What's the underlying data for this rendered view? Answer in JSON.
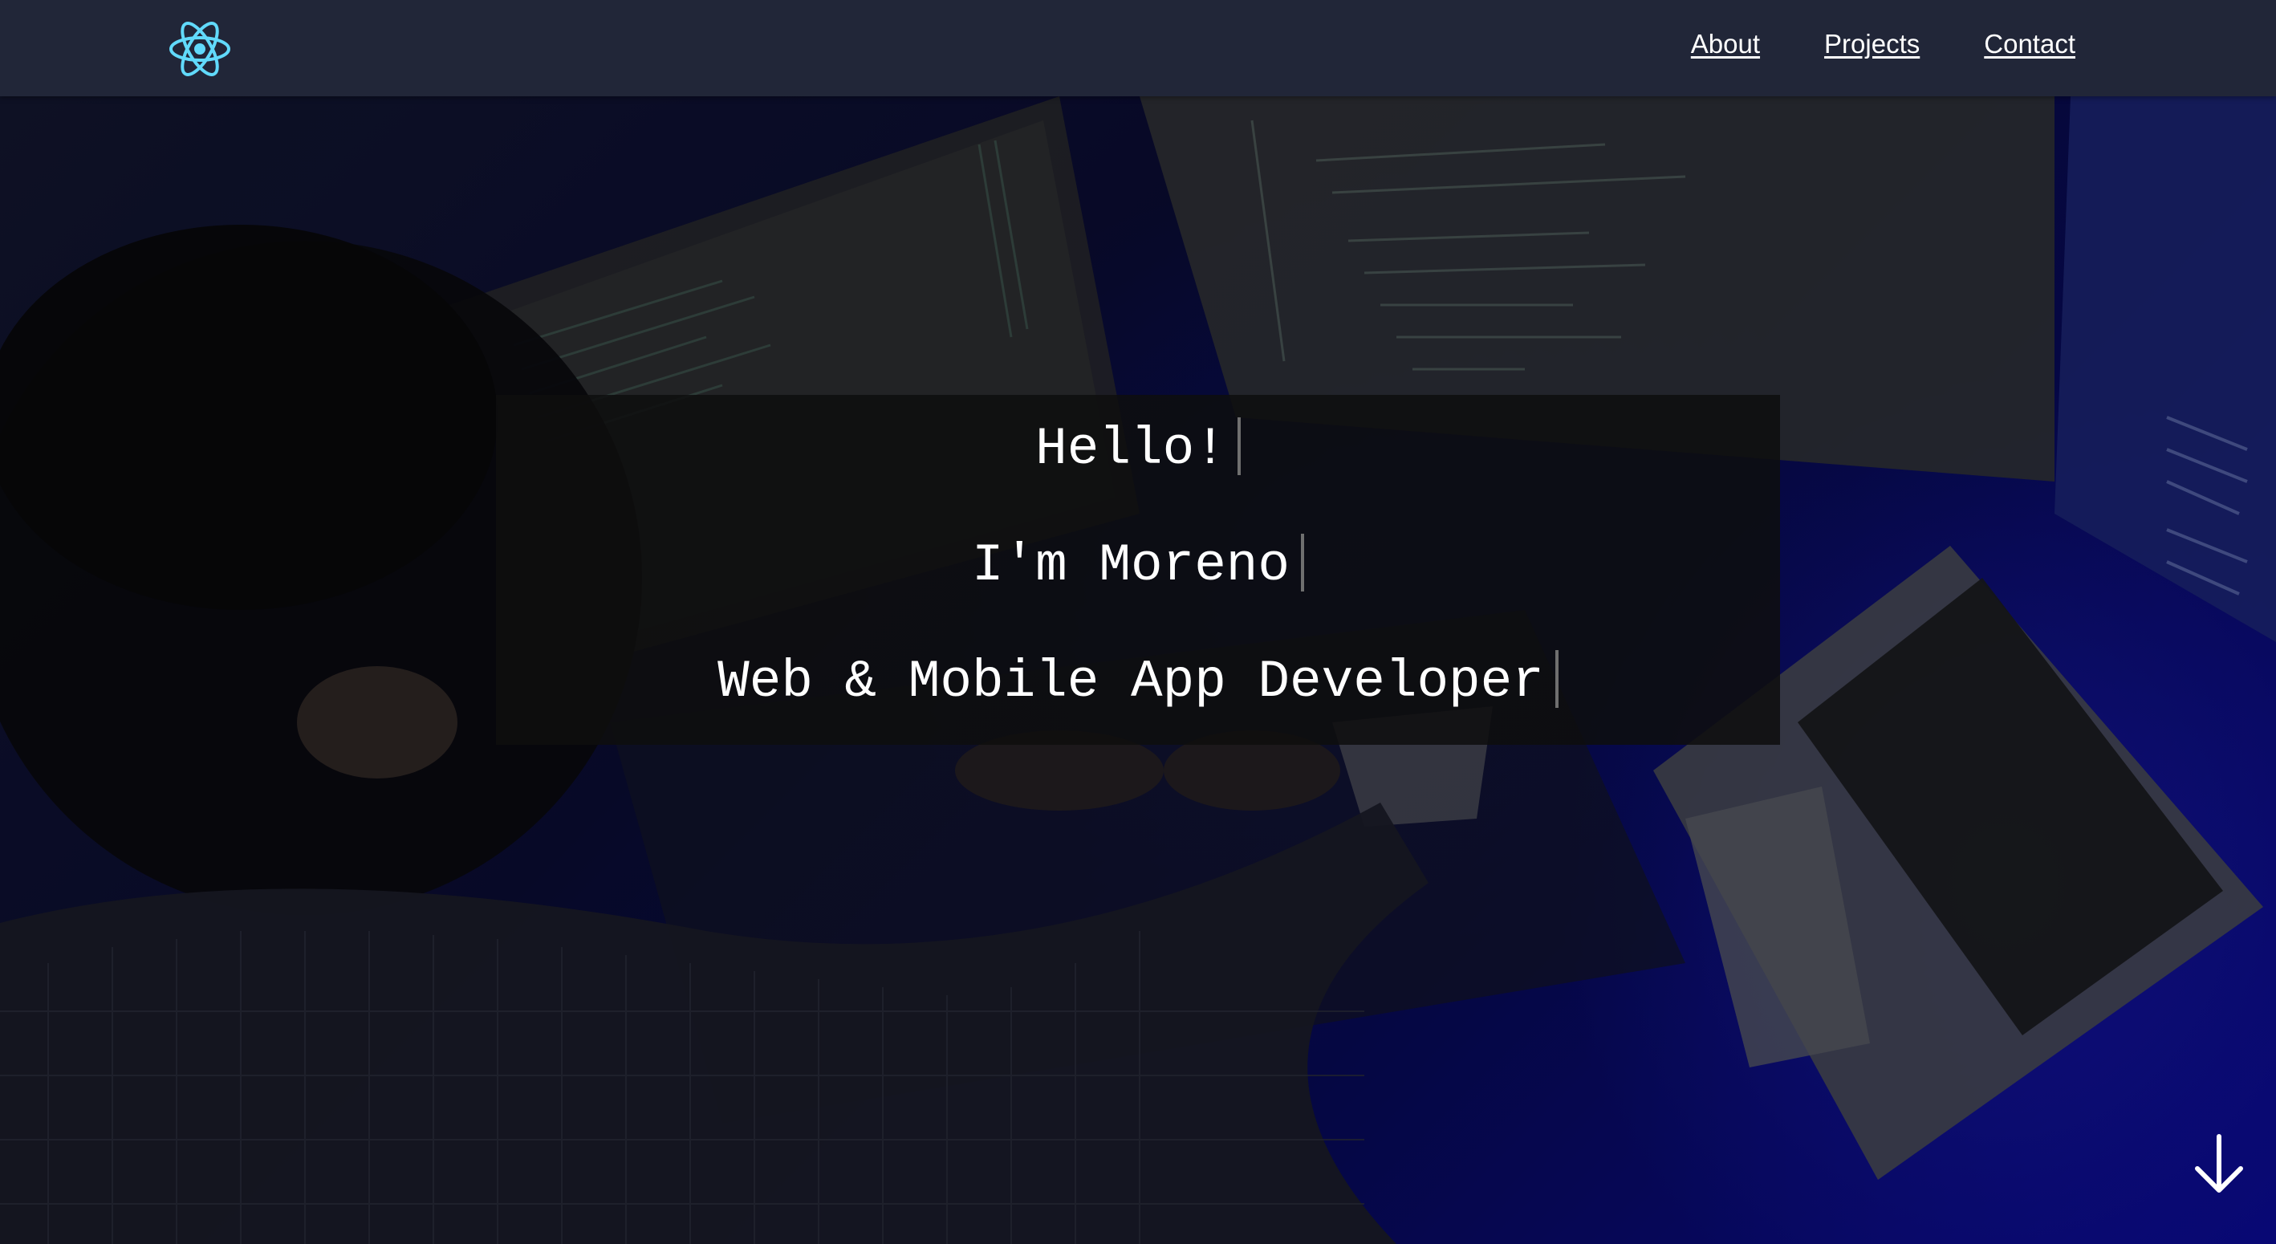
{
  "nav": {
    "logo": {
      "icon": "react-atom-icon",
      "color": "#61dafb"
    },
    "links": [
      {
        "label": "About"
      },
      {
        "label": "Projects"
      },
      {
        "label": "Contact"
      }
    ]
  },
  "hero": {
    "lines": [
      "Hello!",
      "I'm Moreno",
      "Web & Mobile App Developer"
    ],
    "scroll_icon": "arrow-down-icon"
  },
  "colors": {
    "navbar_bg": "#212638",
    "accent": "#61dafb",
    "text": "#ffffff",
    "intro_box_bg": "#0e0e0e"
  }
}
